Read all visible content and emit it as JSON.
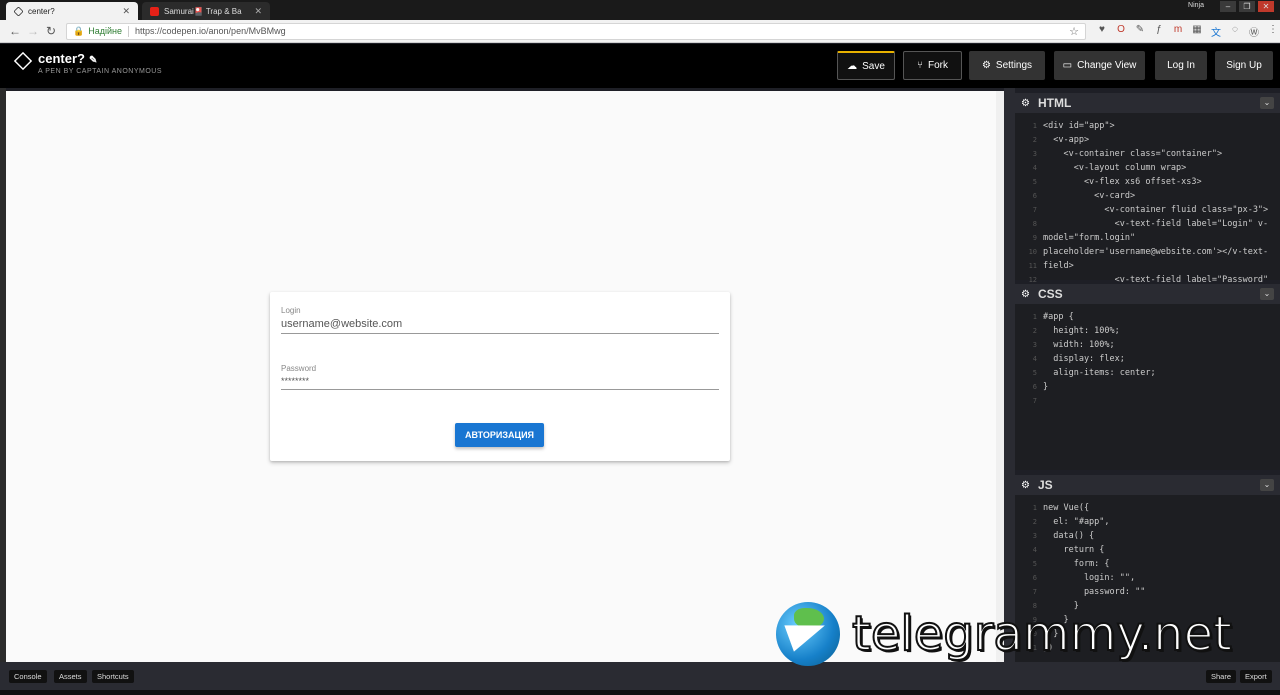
{
  "browser": {
    "tabs": [
      {
        "title": "center?",
        "active": true
      },
      {
        "title": "Samurai🎴 Trap & Ba",
        "active": false
      }
    ],
    "profile": "Ninja",
    "secure_label": "Надійне",
    "url": "https://codepen.io/anon/pen/MvBMwg"
  },
  "header": {
    "title": "center?",
    "subtitle": "A PEN BY CAPTAIN ANONYMOUS",
    "buttons": {
      "save": "Save",
      "fork": "Fork",
      "settings": "Settings",
      "change_view": "Change View",
      "login": "Log In",
      "signup": "Sign Up"
    }
  },
  "preview": {
    "login_label": "Login",
    "login_placeholder": "username@website.com",
    "password_label": "Password",
    "password_value": "********",
    "auth_button": "АВТОРИЗАЦИЯ"
  },
  "editors": {
    "html": {
      "name": "HTML",
      "lines": [
        "<div id=\"app\">",
        "  <v-app>",
        "    <v-container class=\"container\">",
        "      <v-layout column wrap>",
        "        <v-flex xs6 offset-xs3>",
        "          <v-card>",
        "            <v-container fluid class=\"px-3\">",
        "              <v-text-field label=\"Login\" v-",
        "model=\"form.login\"",
        "placeholder='username@website.com'></v-text-",
        "field>",
        "              <v-text-field label=\"Password\""
      ]
    },
    "css": {
      "name": "CSS",
      "lines": [
        "#app {",
        "  height: 100%;",
        "  width: 100%;",
        "  display: flex;",
        "  align-items: center;",
        "}",
        ""
      ]
    },
    "js": {
      "name": "JS",
      "lines": [
        "new Vue({",
        "  el: \"#app\",",
        "  data() {",
        "    return {",
        "      form: {",
        "        login: \"\",",
        "        password: \"\"",
        "      }",
        "    }",
        "  }",
        "})"
      ]
    }
  },
  "footer": {
    "console": "Console",
    "assets": "Assets",
    "shortcuts": "Shortcuts",
    "share": "Share",
    "export": "Export"
  },
  "watermark": "telegrammy.net"
}
